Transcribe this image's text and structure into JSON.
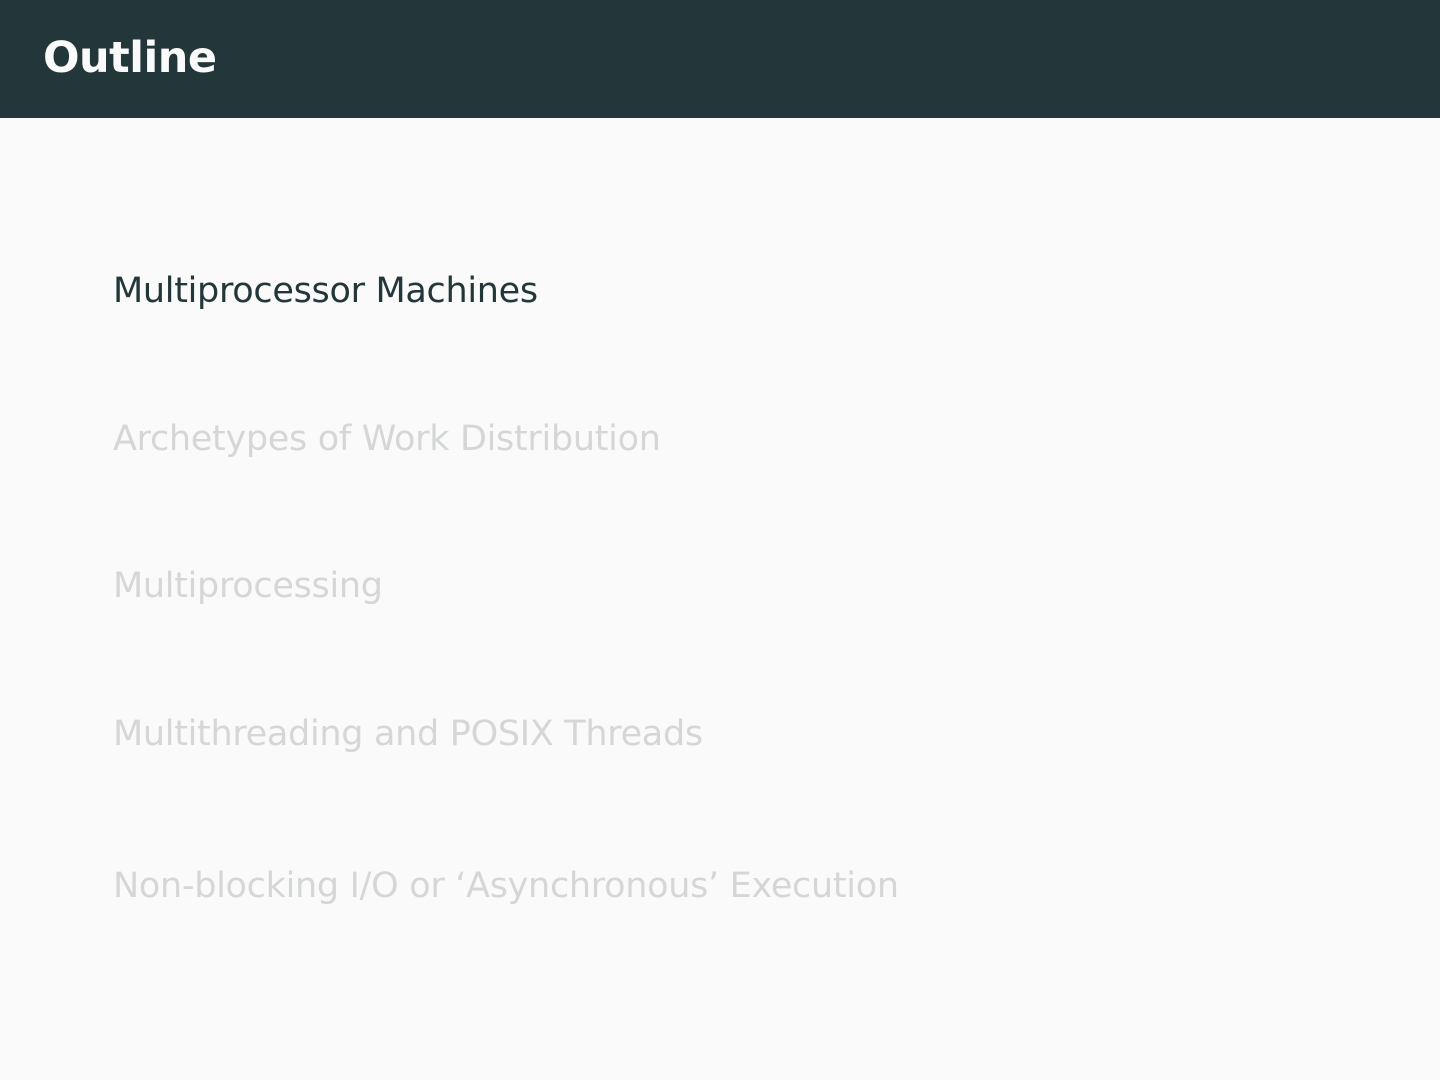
{
  "slide": {
    "title": "Outline",
    "sections": [
      {
        "label": "Multiprocessor Machines",
        "active": true
      },
      {
        "label": "Archetypes of Work Distribution",
        "active": false
      },
      {
        "label": "Multiprocessing",
        "active": false
      },
      {
        "label": "Multithreading and POSIX Threads",
        "active": false
      },
      {
        "label": "Non-blocking I/O or ‘Asynchronous’ Execution",
        "active": false
      }
    ]
  },
  "colors": {
    "header": "#23373b",
    "background": "#fafafa",
    "active_text": "#23373b",
    "inactive_text": "#d5d6d6"
  }
}
